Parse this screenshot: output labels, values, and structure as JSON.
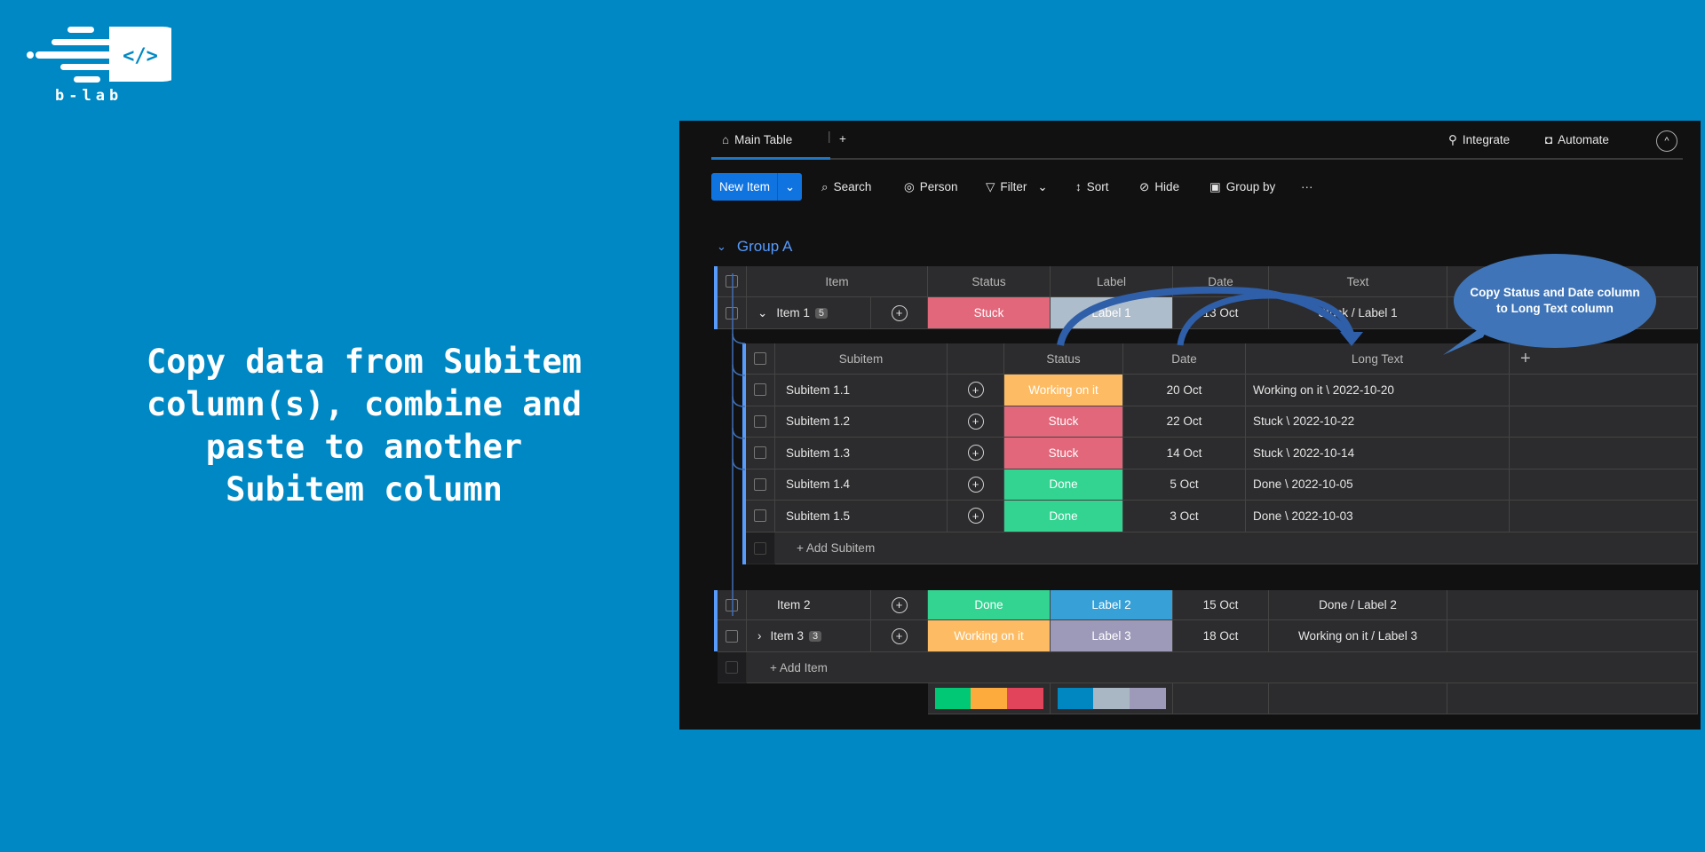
{
  "brand": {
    "name": "b-lab",
    "icon": "code-brackets-icon"
  },
  "headline": [
    "Copy data from Subitem",
    "column(s), combine and",
    "paste to another",
    "Subitem column"
  ],
  "app": {
    "tabs": [
      {
        "label": "Main Table",
        "icon": "home-icon",
        "active": true
      }
    ],
    "add_tab": "+",
    "integrate": "Integrate",
    "automate": "Automate",
    "toolbar": {
      "new_item": "New Item",
      "search": "Search",
      "person": "Person",
      "filter": "Filter",
      "sort": "Sort",
      "hide": "Hide",
      "group_by": "Group by",
      "more": "···"
    },
    "group": {
      "title": "Group A",
      "color": "#579bfc"
    },
    "columns": [
      "Item",
      "Status",
      "Label",
      "Date",
      "Text"
    ],
    "items": [
      {
        "name": "Item 1",
        "count": "5",
        "status": "Stuck",
        "status_color": "#e2677b",
        "label": "Label 1",
        "label_color": "#aebdcc",
        "date": "13 Oct",
        "text": "Stuck / Label 1",
        "expanded": true
      },
      {
        "name": "Item 2",
        "count": "",
        "status": "Done",
        "status_color": "#33d391",
        "label": "Label 2",
        "label_color": "#37a0d7",
        "date": "15 Oct",
        "text": "Done / Label 2"
      },
      {
        "name": "Item 3",
        "count": "3",
        "status": "Working on it",
        "status_color": "#fdbc64",
        "label": "Label 3",
        "label_color": "#9d99b9",
        "date": "18 Oct",
        "text": "Working on it / Label 3"
      }
    ],
    "sub_columns": [
      "Subitem",
      "Status",
      "Date",
      "Long Text",
      "+"
    ],
    "subitems": [
      {
        "name": "Subitem 1.1",
        "status": "Working on it",
        "status_color": "#fdbc64",
        "date": "20 Oct",
        "long_text": "Working on it \\ 2022-10-20"
      },
      {
        "name": "Subitem 1.2",
        "status": "Stuck",
        "status_color": "#e2677b",
        "date": "22 Oct",
        "long_text": "Stuck \\ 2022-10-22"
      },
      {
        "name": "Subitem 1.3",
        "status": "Stuck",
        "status_color": "#e2677b",
        "date": "14 Oct",
        "long_text": "Stuck \\ 2022-10-14"
      },
      {
        "name": "Subitem 1.4",
        "status": "Done",
        "status_color": "#33d391",
        "date": "5 Oct",
        "long_text": "Done \\ 2022-10-05"
      },
      {
        "name": "Subitem 1.5",
        "status": "Done",
        "status_color": "#33d391",
        "date": "3 Oct",
        "long_text": "Done \\ 2022-10-03"
      }
    ],
    "add_subitem": "+ Add Subitem",
    "add_item": "+ Add Item",
    "status_summary": [
      "#00c875",
      "#fdab3d",
      "#e2445c"
    ],
    "label_summary": [
      "#0086c0",
      "#a9b7c4",
      "#9d99b9"
    ]
  },
  "callout": {
    "line1": "Copy Status and Date column",
    "line2": "to Long Text column"
  }
}
